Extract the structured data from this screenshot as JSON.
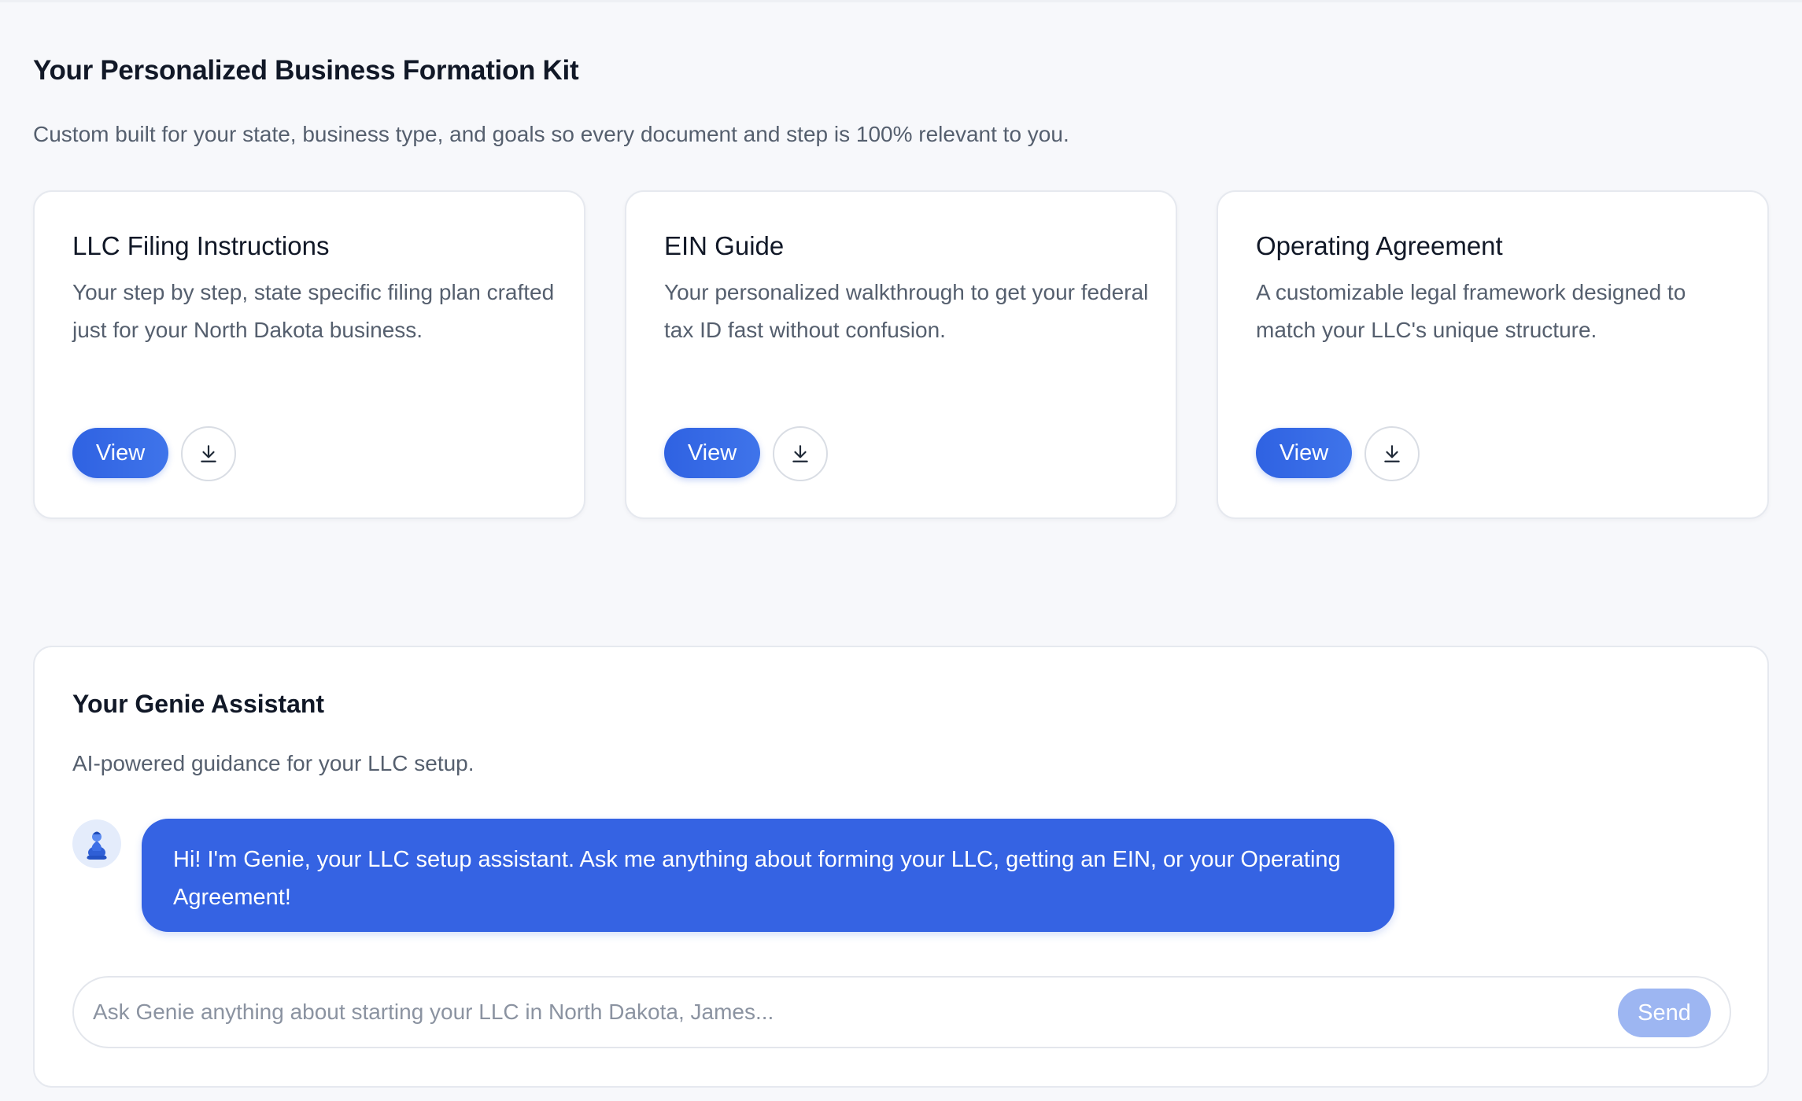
{
  "kit": {
    "title": "Your Personalized Business Formation Kit",
    "subtitle": "Custom built for your state, business type, and goals so every document and step is 100% relevant to you."
  },
  "cards": [
    {
      "title": "LLC Filing Instructions",
      "description": "Your step by step, state specific filing plan crafted just for your North Dakota business.",
      "view_label": "View",
      "download_icon": "download-icon"
    },
    {
      "title": "EIN Guide",
      "description": "Your personalized walkthrough to get your federal tax ID fast without confusion.",
      "view_label": "View",
      "download_icon": "download-icon"
    },
    {
      "title": "Operating Agreement",
      "description": "A customizable legal framework designed to match your LLC's unique structure.",
      "view_label": "View",
      "download_icon": "download-icon"
    }
  ],
  "assistant": {
    "title": "Your Genie Assistant",
    "subtitle": "AI-powered guidance for your LLC setup.",
    "avatar_icon": "genie-icon",
    "message": "Hi! I'm Genie, your LLC setup assistant. Ask me anything about forming your LLC, getting an EIN, or your Operating Agreement!",
    "input_placeholder": "Ask Genie anything about starting your LLC in North Dakota, James...",
    "input_value": "",
    "send_label": "Send"
  },
  "colors": {
    "accent": "#3563e3",
    "send_disabled": "#9db6f2",
    "background": "#f7f8fb"
  }
}
